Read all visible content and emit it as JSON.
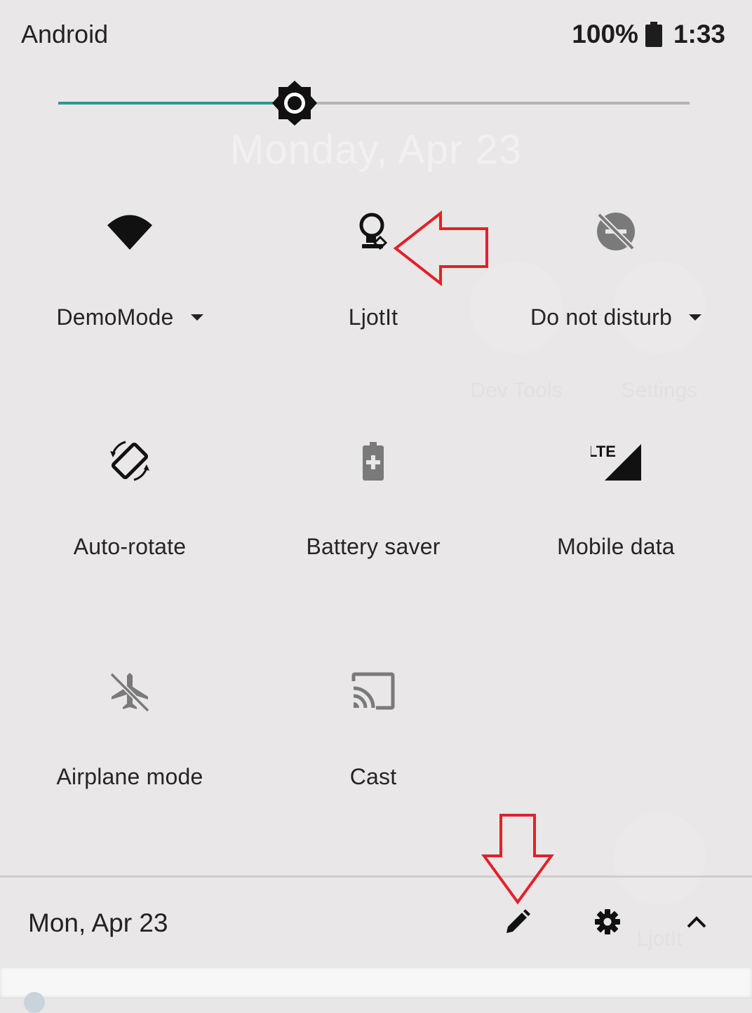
{
  "status_bar": {
    "device_name": "Android",
    "battery": "100%",
    "time": "1:33"
  },
  "brightness": {
    "level": 0.37
  },
  "background": {
    "date": "Monday, Apr 23",
    "apps": [
      {
        "label": "Dev Tools"
      },
      {
        "label": "Settings"
      },
      {
        "label": "LjotIt"
      }
    ]
  },
  "tiles": [
    {
      "label": "DemoMode",
      "icon": "wifi-icon",
      "has_dropdown": true
    },
    {
      "label": "LjotIt",
      "icon": "lightbulb-icon",
      "has_dropdown": false
    },
    {
      "label": "Do not disturb",
      "icon": "do-not-disturb-icon",
      "has_dropdown": true
    },
    {
      "label": "Auto-rotate",
      "icon": "rotate-icon",
      "has_dropdown": false
    },
    {
      "label": "Battery saver",
      "icon": "battery-saver-icon",
      "has_dropdown": false
    },
    {
      "label": "Mobile data",
      "icon": "lte-signal-icon",
      "has_dropdown": false
    },
    {
      "label": "Airplane mode",
      "icon": "airplane-off-icon",
      "has_dropdown": false
    },
    {
      "label": "Cast",
      "icon": "cast-icon",
      "has_dropdown": false
    }
  ],
  "footer": {
    "date": "Mon, Apr 23",
    "edit_icon": "pencil-icon",
    "settings_icon": "gear-icon",
    "collapse_icon": "chevron-up-icon"
  },
  "annotations": {
    "color": "#e3202a"
  },
  "colors": {
    "accent": "#2a9a8c",
    "background": "#e9e7e7"
  }
}
